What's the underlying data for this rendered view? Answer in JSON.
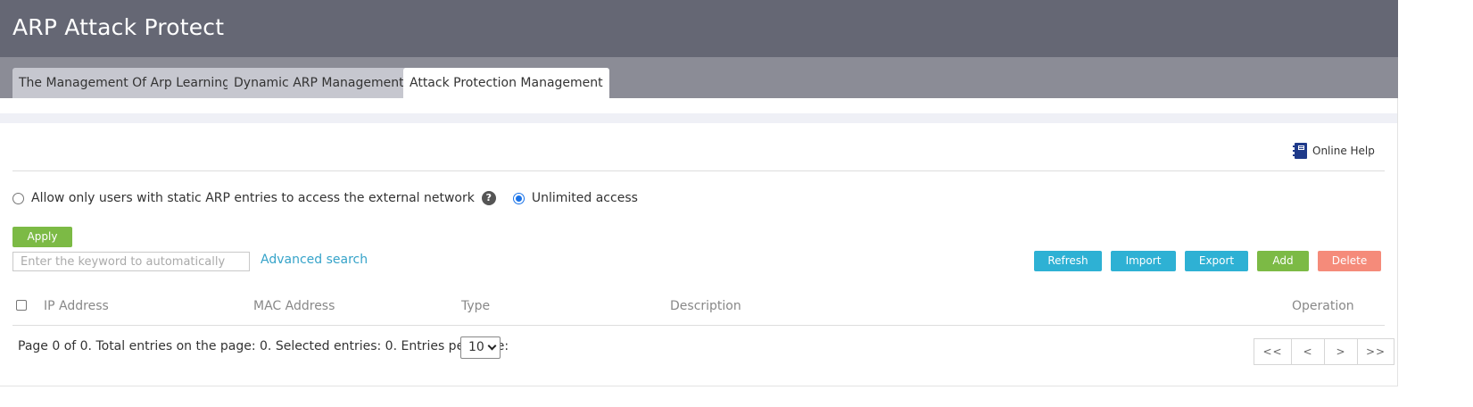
{
  "header": {
    "title": "ARP Attack Protect"
  },
  "tabs": [
    {
      "label": "The Management Of Arp Learning",
      "active": false
    },
    {
      "label": "Dynamic ARP Management",
      "active": false
    },
    {
      "label": "Attack Protection Management",
      "active": true
    }
  ],
  "help": {
    "label": "Online Help",
    "icon": "book-icon"
  },
  "access_mode": {
    "options": [
      {
        "label": "Allow only users with static ARP entries to access the external network",
        "checked": false
      },
      {
        "label": "Unlimited access",
        "checked": true
      }
    ],
    "help_icon": "question-icon",
    "apply_label": "Apply"
  },
  "search": {
    "placeholder": "Enter the keyword to automatically",
    "value": "",
    "advanced_label": "Advanced search"
  },
  "toolbar": {
    "refresh_label": "Refresh",
    "import_label": "Import",
    "export_label": "Export",
    "add_label": "Add",
    "delete_label": "Delete"
  },
  "table": {
    "columns": [
      "IP Address",
      "MAC Address",
      "Type",
      "Description",
      "Operation"
    ],
    "rows": []
  },
  "pagination": {
    "summary": "Page 0 of 0. Total entries on the page: 0. Selected entries: 0. Entries per page:",
    "per_page": "10",
    "first_label": "<<",
    "prev_label": "<",
    "next_label": ">",
    "last_label": ">>"
  },
  "colors": {
    "header_bg": "#656774",
    "tabbar_bg": "#8b8c96",
    "green": "#7cba45",
    "blue": "#2eb1d4",
    "red": "#f58b7a",
    "link": "#35a3c9"
  }
}
